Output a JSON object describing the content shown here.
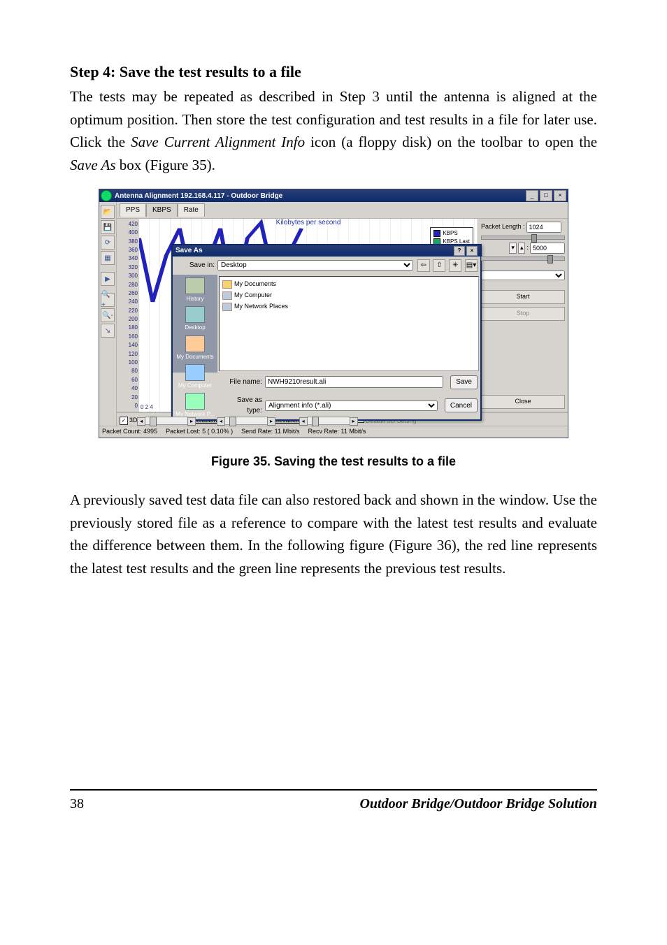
{
  "step": {
    "heading": "Step 4: Save the test results to a file",
    "para1_a": "The tests may be repeated as described in Step 3 until the antenna is aligned at the optimum position. Then store the test configuration and test results in a file for later use. Click the ",
    "para1_em1": "Save Current Alignment Info",
    "para1_b": " icon (a floppy disk) on the toolbar to open the ",
    "para1_em2": "Save As",
    "para1_c": " box (Figure 35)."
  },
  "app": {
    "title": "Antenna Alignment 192.168.4.117 - Outdoor Bridge",
    "tabs": {
      "pps": "PPS",
      "kbps": "KBPS",
      "rate": "Rate"
    },
    "chart": {
      "title": "Kilobytes per second",
      "legend1": "KBPS",
      "legend2": "KBPS Last",
      "yticks": [
        "0",
        "20",
        "40",
        "60",
        "80",
        "100",
        "120",
        "140",
        "160",
        "180",
        "200",
        "220",
        "240",
        "260",
        "280",
        "300",
        "320",
        "340",
        "360",
        "380",
        "400",
        "420"
      ],
      "xticks": "0 2 4"
    },
    "right": {
      "pkt_label": "Packet Length :",
      "pkt_value": "1024",
      "count_value": "5000",
      "start": "Start",
      "stop": "Stop",
      "close": "Close"
    },
    "saveas": {
      "title": "Save As",
      "savein_label": "Save in:",
      "savein_value": "Desktop",
      "places": {
        "history": "History",
        "desktop": "Desktop",
        "mydocs": "My Documents",
        "mycomp": "My Computer",
        "mynet": "My Network P..."
      },
      "files": {
        "mydocs": "My Documents",
        "mycomp": "My Computer",
        "mynet": "My Network Places"
      },
      "filename_label": "File name:",
      "filename_value": "NWH9210result.ali",
      "savetype_label": "Save as type:",
      "savetype_value": "Alignment info (*.ali)",
      "save_btn": "Save",
      "cancel_btn": "Cancel"
    },
    "bottom": {
      "three_d": "3D:",
      "rotation": "Rotation:",
      "elevation": "Elevation:",
      "default3d": "Default 3D Setting"
    },
    "statusbar": {
      "a": "Packet Count: 4995",
      "b": "Packet Lost: 5 ( 0.10% )",
      "c": "Send Rate: 11 Mbit/s",
      "d": "Recv Rate: 11 Mbit/s"
    }
  },
  "figcaption": "Figure 35.  Saving the test results to a file",
  "para2": "A previously saved test data file can also restored back and shown in the window. Use the previously stored file as a reference to compare with the latest test results and evaluate the difference between them. In the following figure (Figure 36), the red line represents the latest test results and the green line represents the previous test results.",
  "footer": {
    "page": "38",
    "title": "Outdoor Bridge/Outdoor Bridge Solution"
  },
  "chart_data": {
    "type": "line",
    "title": "Kilobytes per second",
    "ylabel": "KBPS",
    "ylim": [
      0,
      420
    ],
    "series": [
      {
        "name": "KBPS",
        "values": [
          380,
          240,
          340,
          400,
          260,
          320,
          400,
          240,
          380,
          410,
          280,
          340,
          400
        ]
      }
    ]
  }
}
